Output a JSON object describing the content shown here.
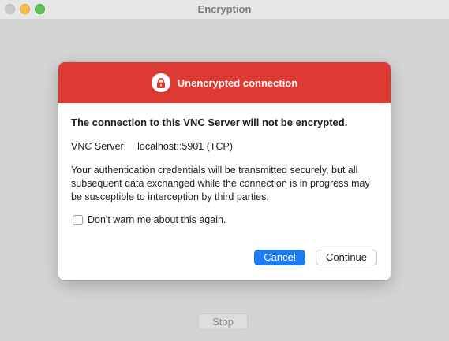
{
  "window": {
    "title": "Encryption"
  },
  "background": {
    "stop_label": "Stop"
  },
  "dialog": {
    "header_title": "Unencrypted connection",
    "header_icon": "lock-icon",
    "header_color": "#dc3a33",
    "headline": "The connection to this VNC Server will not be encrypted.",
    "server_label": "VNC Server:",
    "server_value": "localhost::5901 (TCP)",
    "message": "Your authentication credentials will be transmitted securely, but all subsequent data exchanged while the connection is in progress may be susceptible to interception by third parties.",
    "checkbox_label": "Don't warn me about this again.",
    "checkbox_checked": false,
    "cancel_label": "Cancel",
    "continue_label": "Continue",
    "accent_color": "#1b7cf4"
  }
}
